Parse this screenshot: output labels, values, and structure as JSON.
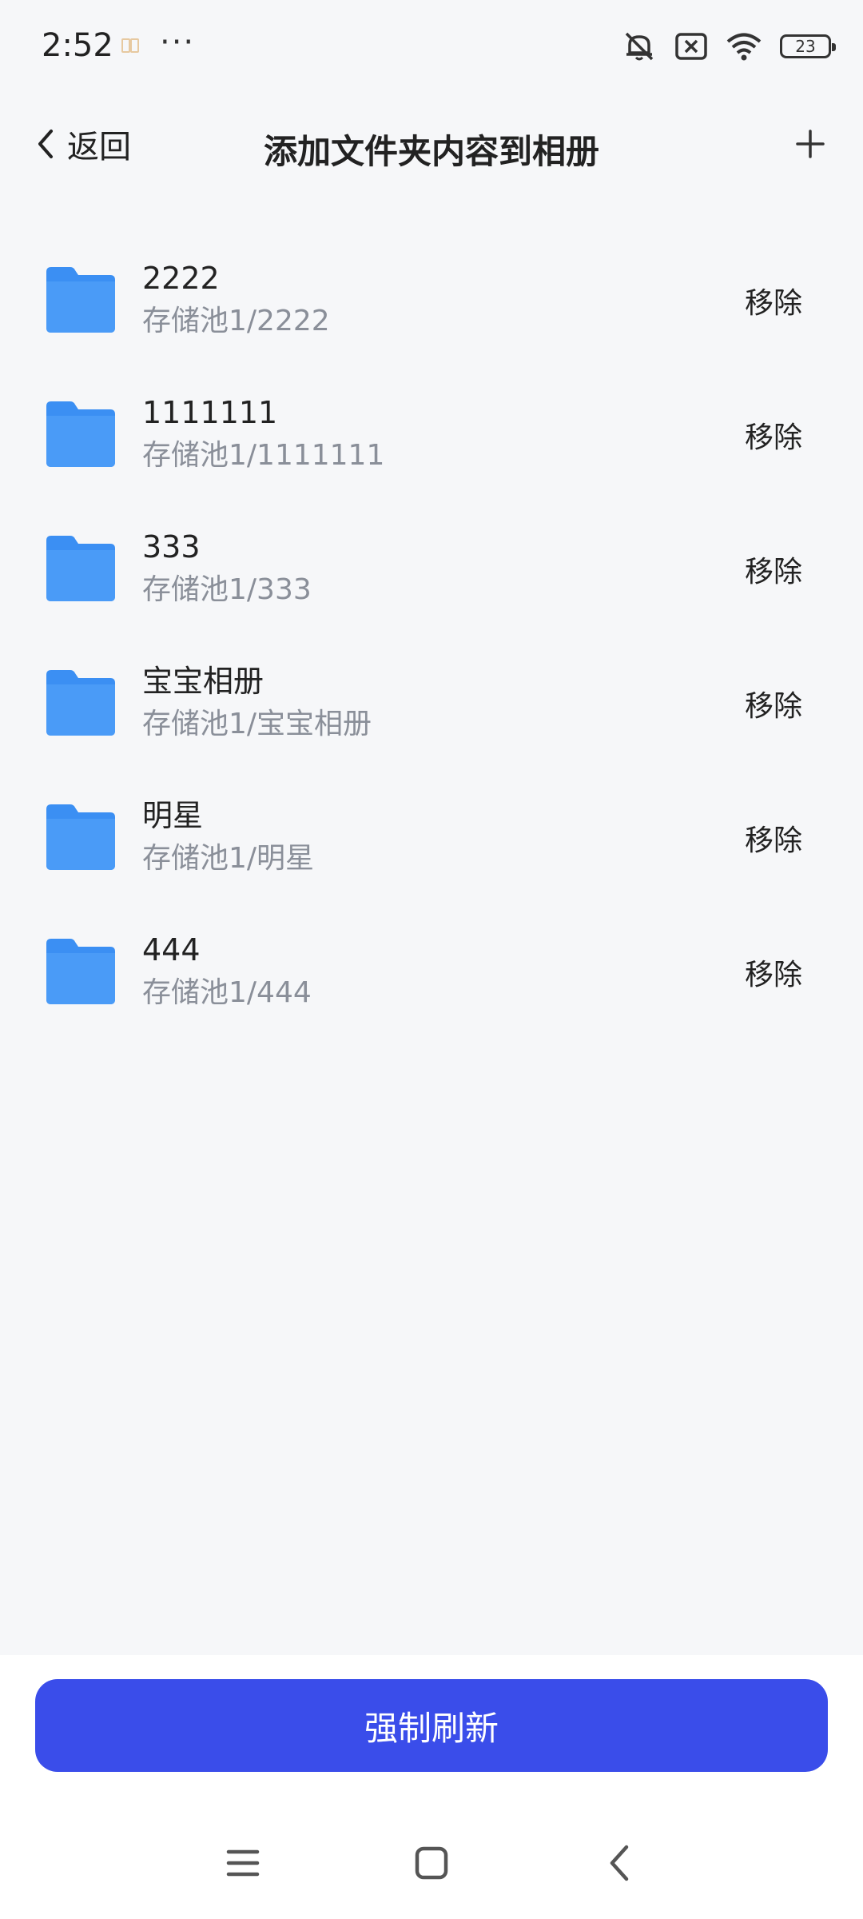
{
  "status_bar": {
    "time": "2:52",
    "more": "···",
    "battery_level": "23",
    "icons": [
      "notification-book-icon",
      "mute-icon",
      "sim-disabled-icon",
      "wifi-icon",
      "battery-icon"
    ]
  },
  "header": {
    "back_label": "返回",
    "title": "添加文件夹内容到相册",
    "add_icon": "plus-icon"
  },
  "folders": [
    {
      "name": "2222",
      "path": "存储池1/2222",
      "action": "移除"
    },
    {
      "name": "1111111",
      "path": "存储池1/1111111",
      "action": "移除"
    },
    {
      "name": "333",
      "path": "存储池1/333",
      "action": "移除"
    },
    {
      "name": "宝宝相册",
      "path": "存储池1/宝宝相册",
      "action": "移除"
    },
    {
      "name": "明星",
      "path": "存储池1/明星",
      "action": "移除"
    },
    {
      "name": "444",
      "path": "存储池1/444",
      "action": "移除"
    }
  ],
  "footer": {
    "refresh_label": "强制刷新"
  },
  "colors": {
    "accent": "#3A4DEA",
    "folder": "#3B8FF3",
    "background": "#F6F7F9",
    "secondary_text": "#8A8F99"
  },
  "nav_icons": [
    "menu-icon",
    "home-icon",
    "back-icon"
  ]
}
